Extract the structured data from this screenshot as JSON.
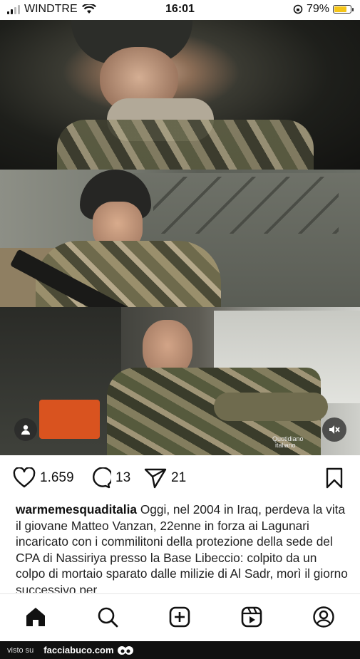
{
  "status_bar": {
    "carrier": "WINDTRE",
    "time": "16:01",
    "battery_percent": "79%",
    "battery_level": 0.79,
    "icons": [
      "signal-icon",
      "wifi-icon",
      "orientation-lock-icon",
      "battery-icon"
    ]
  },
  "post": {
    "media_watermark": [
      "Quotidiano",
      "italiano"
    ],
    "actions": {
      "likes": "1.659",
      "comments": "13",
      "shares": "21"
    },
    "caption_username": "warmemesquaditalia",
    "caption_text": "Oggi, nel 2004 in Iraq, perdeva la vita il giovane Matteo Vanzan, 22enne in forza ai Lagunari incaricato con i commilitoni della protezione della sede del CPA di Nassiriya presso la Base Libeccio: colpito da un colpo di mortaio sparato dalle milizie di Al Sadr, morì il giorno successivo per"
  },
  "tab_bar": [
    "home-icon",
    "search-icon",
    "new-post-icon",
    "reels-icon",
    "profile-icon"
  ],
  "footer": {
    "prefix": "visto su",
    "site": "facciabuco.com"
  },
  "colors": {
    "accent_battery": "#f5c518",
    "text": "#111111"
  }
}
